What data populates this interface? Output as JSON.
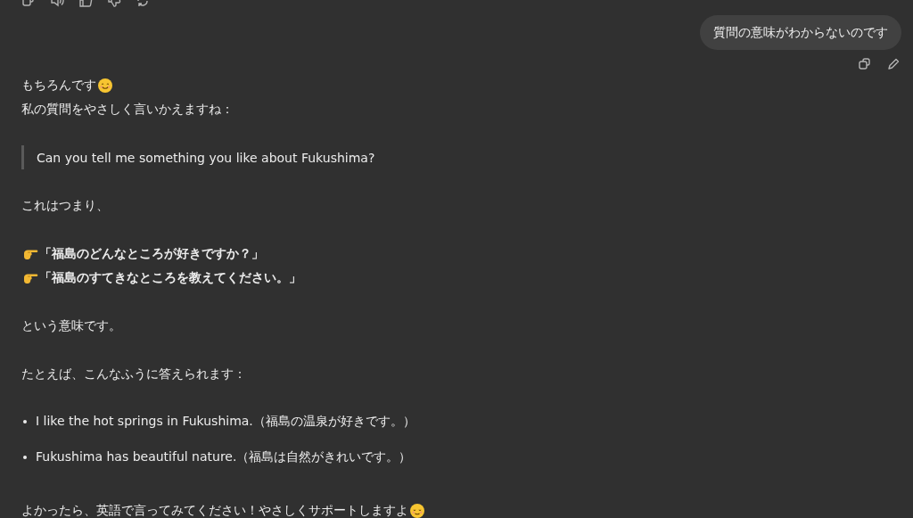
{
  "user_message": {
    "text": "質問の意味がわからないのです"
  },
  "assistant_message": {
    "blocks": [
      {
        "kind": "paragraph",
        "lines": [
          {
            "kind": "smile_after",
            "text": "もちろんです",
            "bold": false
          },
          {
            "kind": "plain",
            "text": "私の質問をやさしく言いかえますね：",
            "bold": false
          }
        ]
      },
      {
        "kind": "quote",
        "lines": [
          {
            "kind": "plain",
            "text": "Can you tell me something you like about Fukushima?",
            "bold": false
          }
        ]
      },
      {
        "kind": "paragraph",
        "lines": [
          {
            "kind": "plain",
            "text": "これはつまり、",
            "bold": false
          }
        ]
      },
      {
        "kind": "paragraph",
        "lines": [
          {
            "kind": "point_before",
            "text": "「福島のどんなところが好きですか？」",
            "bold": true
          },
          {
            "kind": "point_before",
            "text": "「福島のすてきなところを教えてください。」",
            "bold": true
          }
        ]
      },
      {
        "kind": "paragraph",
        "lines": [
          {
            "kind": "plain",
            "text": "という意味です。",
            "bold": false
          }
        ]
      },
      {
        "kind": "paragraph",
        "lines": [
          {
            "kind": "plain",
            "text": "たとえば、こんなふうに答えられます：",
            "bold": false
          }
        ]
      },
      {
        "kind": "list",
        "lines": [
          {
            "kind": "plain",
            "text": "I like the hot springs in Fukushima.（福島の温泉が好きです。）",
            "bold": false
          },
          {
            "kind": "plain",
            "text": "Fukushima has beautiful nature.（福島は自然がきれいです。）",
            "bold": false
          }
        ]
      },
      {
        "kind": "paragraph",
        "lines": [
          {
            "kind": "relieved_after",
            "text": "よかったら、英語で言ってみてください！やさしくサポートしますよ",
            "bold": false
          }
        ]
      }
    ]
  }
}
